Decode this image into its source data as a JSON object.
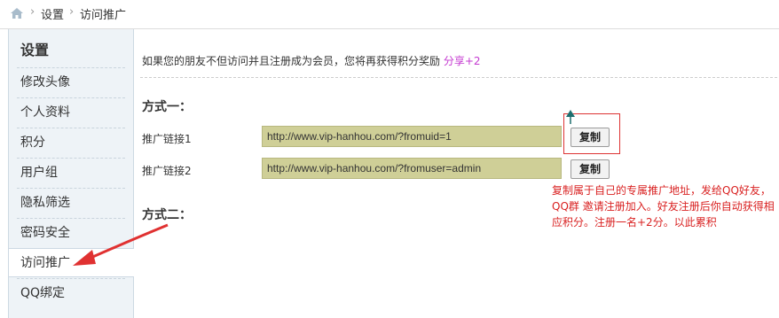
{
  "breadcrumb": {
    "home_icon": "home-icon",
    "separator": "›",
    "items": [
      "设置",
      "访问推广"
    ]
  },
  "sidebar": {
    "title": "设置",
    "items": [
      {
        "label": "修改头像",
        "active": false
      },
      {
        "label": "个人资料",
        "active": false
      },
      {
        "label": "积分",
        "active": false
      },
      {
        "label": "用户组",
        "active": false
      },
      {
        "label": "隐私筛选",
        "active": false
      },
      {
        "label": "密码安全",
        "active": false
      },
      {
        "label": "访问推广",
        "active": true
      },
      {
        "label": "QQ绑定",
        "active": false
      }
    ]
  },
  "main": {
    "intro": "如果您的朋友不但访问并且注册成为会员，您将再获得积分奖励",
    "share_text": "分享+2",
    "method1": "方式一：",
    "method2": "方式二：",
    "links": [
      {
        "label": "推广链接1",
        "value": "http://www.vip-hanhou.com/?fromuid=1",
        "button": "复制"
      },
      {
        "label": "推广链接2",
        "value": "http://www.vip-hanhou.com/?fromuser=admin",
        "button": "复制"
      }
    ]
  },
  "annotation": {
    "note": "复制属于自己的专属推广地址，发给QQ好友，QQ群 邀请注册加入。好友注册后你自动获得相应积分。注册一名+2分。以此累积"
  },
  "colors": {
    "sidebar_bg": "#eef3f7",
    "input_bg": "#cfcf97",
    "share": "#c43ad0",
    "annotation_red": "#d92121"
  }
}
